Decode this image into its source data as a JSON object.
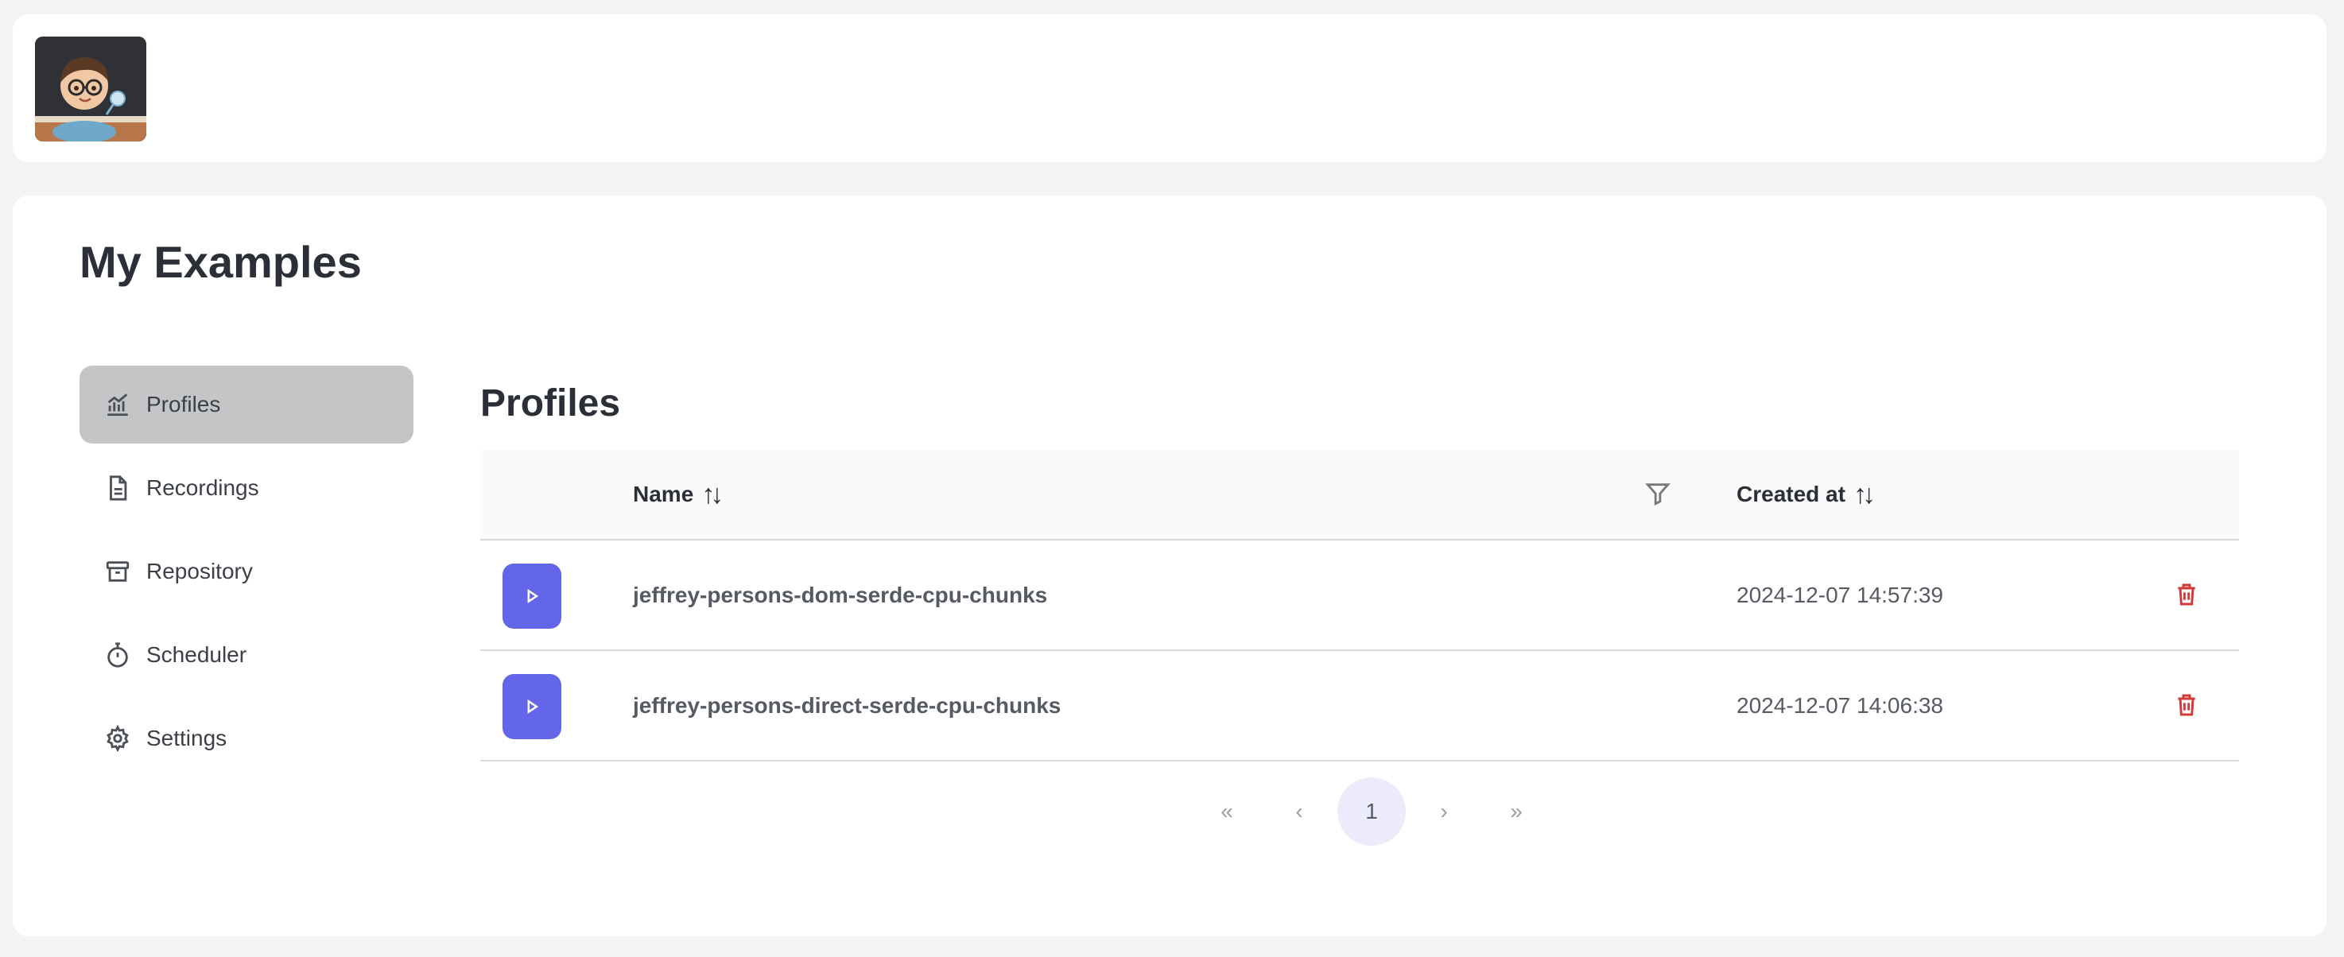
{
  "header": {
    "avatar_icon": "user-avatar-cartoon"
  },
  "page": {
    "title": "My Examples"
  },
  "sidebar": {
    "items": [
      {
        "label": "Profiles",
        "icon": "chart-icon",
        "active": true
      },
      {
        "label": "Recordings",
        "icon": "document-icon",
        "active": false
      },
      {
        "label": "Repository",
        "icon": "archive-icon",
        "active": false
      },
      {
        "label": "Scheduler",
        "icon": "stopwatch-icon",
        "active": false
      },
      {
        "label": "Settings",
        "icon": "gear-icon",
        "active": false
      }
    ]
  },
  "profiles": {
    "title": "Profiles",
    "columns": {
      "name": "Name",
      "created_at": "Created at",
      "sort_glyph": "↑↓"
    },
    "rows": [
      {
        "name": "jeffrey-persons-dom-serde-cpu-chunks",
        "created_at": "2024-12-07 14:57:39"
      },
      {
        "name": "jeffrey-persons-direct-serde-cpu-chunks",
        "created_at": "2024-12-07 14:06:38"
      }
    ]
  },
  "pagination": {
    "first": "«",
    "prev": "‹",
    "current": "1",
    "next": "›",
    "last": "»"
  },
  "colors": {
    "accent": "#6466e9",
    "danger": "#d23a3a",
    "active_nav": "#c4c5c6"
  }
}
